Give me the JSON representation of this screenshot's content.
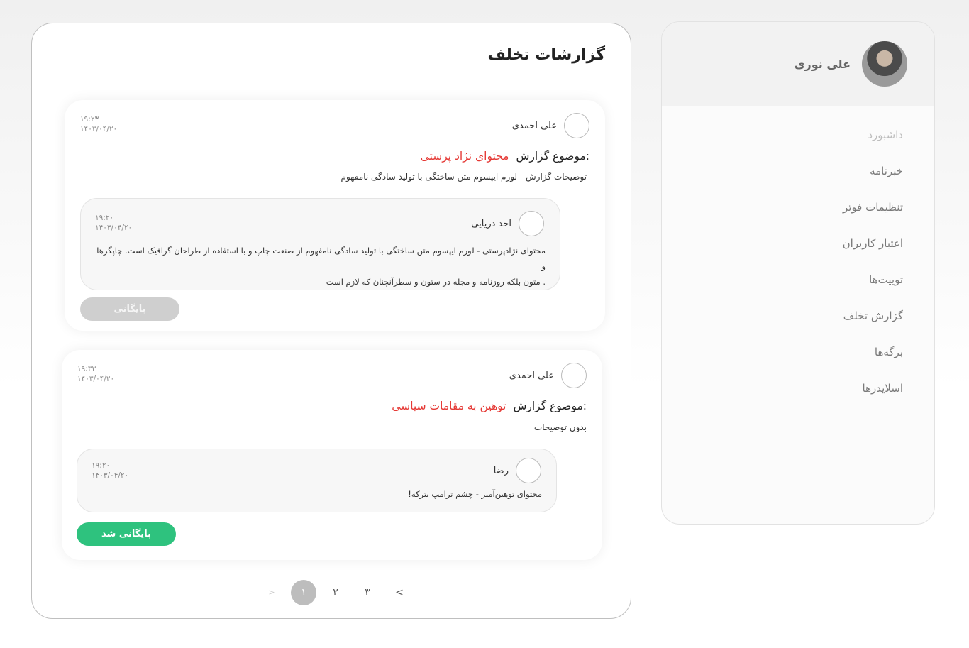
{
  "sidebar": {
    "user_name": "علی نوری",
    "items": [
      {
        "label": "داشبورد"
      },
      {
        "label": "خبرنامه"
      },
      {
        "label": "تنظیمات فوتر"
      },
      {
        "label": "اعتبار کاربران"
      },
      {
        "label": "توییت‌ها"
      },
      {
        "label": "گزارش تخلف"
      },
      {
        "label": "برگه‌ها"
      },
      {
        "label": "اسلایدرها"
      }
    ]
  },
  "main": {
    "title": "گزارشات تخلف",
    "subject_label": "موضوع گزارش:",
    "reports": [
      {
        "reporter": "علی احمدی",
        "time": "۱۹:۲۳",
        "date": "۱۴۰۳/۰۴/۲۰",
        "topic": "محتوای نژاد پرستی",
        "description": "توضیحات گزارش - لورم ایپسوم متن ساختگی با تولید سادگی نامفهوم",
        "reply": {
          "author": "احد دریایی",
          "time": "۱۹:۲۰",
          "date": "۱۴۰۳/۰۴/۲۰",
          "line1": "محتوای نژادپرستی - لورم ایپسوم متن ساختگی با تولید سادگی نامفهوم از صنعت چاپ و با استفاده از طراحان گرافیک است. چاپگرها و",
          "line2": ". متون بلکه روزنامه و مجله در ستون و سطرآنچنان که لازم است"
        },
        "button": "بایگانی"
      },
      {
        "reporter": "علی احمدی",
        "time": "۱۹:۳۳",
        "date": "۱۴۰۳/۰۴/۲۰",
        "topic": "توهین به مقامات سیاسی",
        "description": "بدون توضیحات",
        "reply": {
          "author": "رضا",
          "time": "۱۹:۲۰",
          "date": "۱۴۰۳/۰۴/۲۰",
          "line1": "محتوای توهین‌آمیز - چشم ترامپ بترکه!"
        },
        "button": "بایگانی شد"
      }
    ],
    "pagination": {
      "prev": ">",
      "pages": [
        "۱",
        "۲",
        "۳"
      ],
      "next": "<",
      "current": "۱"
    }
  },
  "colors": {
    "topic_red": "#e53935",
    "archived_green": "#2ec27e",
    "archive_gray": "#cfcfcf"
  }
}
